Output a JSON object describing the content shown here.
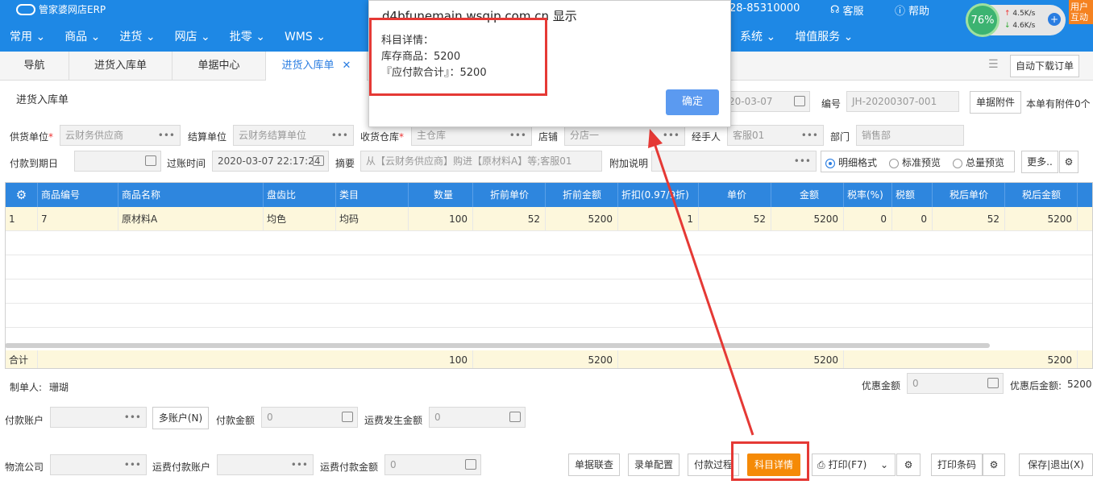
{
  "app": {
    "logo_text": "管家婆网店ERP",
    "phone": "28-85310000",
    "support": "客服",
    "help": "帮助",
    "corner": "用户互动"
  },
  "gauge": {
    "percent": "76%",
    "up": "4.5K/s",
    "down": "4.6K/s"
  },
  "menu": [
    "常用",
    "商品",
    "进货",
    "网店",
    "批零",
    "WMS",
    "系统",
    "增值服务"
  ],
  "tabs": [
    "导航",
    "进货入库单",
    "单据中心",
    "进货入库单"
  ],
  "auto_download": "自动下载订单",
  "form": {
    "title": "进货入库单",
    "date_value": "20-03-07",
    "number_label": "编号",
    "number_value": "JH-20200307-001",
    "attachment_btn": "单据附件",
    "attachment_note": "本单有附件0个",
    "supplier_label": "供货单位",
    "supplier_value": "云财务供应商",
    "settle_label": "结算单位",
    "settle_value": "云财务结算单位",
    "warehouse_label": "收货仓库",
    "warehouse_value": "主仓库",
    "shop_label": "店铺",
    "shop_value": "分店一",
    "handler_label": "经手人",
    "handler_value": "客服01",
    "dept_label": "部门",
    "dept_value": "销售部",
    "due_label": "付款到期日",
    "post_label": "过账时间",
    "post_value": "2020-03-07 22:17:24",
    "summary_label": "摘要",
    "summary_value": "从【云财务供应商】购进【原材料A】等;客服01",
    "note_label": "附加说明",
    "radio": [
      "明细格式",
      "标准预览",
      "总量预览"
    ],
    "more_btn": "更多.."
  },
  "grid": {
    "headers": [
      "商品编号",
      "商品名称",
      "盘齿比",
      "类目",
      "数量",
      "折前单价",
      "折前金额",
      "折扣(0.97/9折)",
      "单价",
      "金额",
      "税率(%)",
      "税额",
      "税后单价",
      "税后金额"
    ],
    "row": {
      "idx": "1",
      "code": "7",
      "name": "原材料A",
      "ratio": "均色",
      "cat": "均码",
      "qty": "100",
      "pre_price": "52",
      "pre_amount": "5200",
      "discount": "1",
      "price": "52",
      "amount": "5200",
      "tax_rate": "0",
      "tax": "0",
      "after_price": "52",
      "after_amount": "5200"
    },
    "sum": {
      "label": "合计",
      "qty": "100",
      "pre_amount": "5200",
      "amount": "5200",
      "after_amount": "5200"
    }
  },
  "footer": {
    "maker_label": "制单人:",
    "maker_value": "珊瑚",
    "discount_label": "优惠金额",
    "discount_value": "0",
    "after_discount_label": "优惠后金额:",
    "after_discount_value": "5200",
    "pay_account_label": "付款账户",
    "multi_account_btn": "多账户(N)",
    "pay_amount_label": "付款金额",
    "pay_amount_value": "0",
    "freight_label": "运费发生金额",
    "freight_value": "0",
    "logistics_label": "物流公司",
    "freight_account_label": "运费付款账户",
    "freight_pay_label": "运费付款金额",
    "freight_pay_value": "0",
    "btn_link": "单据联查",
    "btn_config": "录单配置",
    "btn_process": "付款过程",
    "btn_detail": "科目详情",
    "btn_print": "打印(F7)",
    "btn_barcode": "打印条码",
    "btn_save": "保存|退出(X)"
  },
  "dialog": {
    "title": "d4bfunemain.wsqip.com.cn 显示",
    "line1": "科目详情：",
    "line2": "库存商品：5200",
    "line3": "『应付款合计』：5200",
    "ok": "确定"
  }
}
